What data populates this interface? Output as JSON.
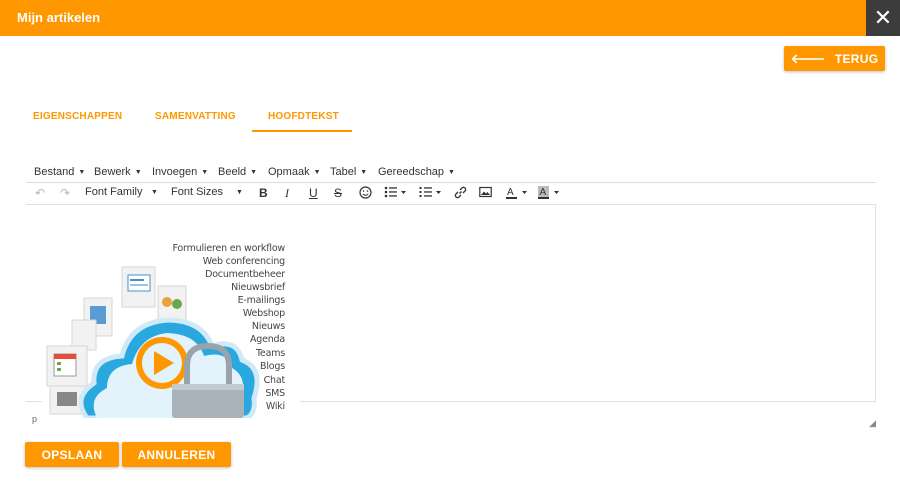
{
  "window": {
    "title": "Mijn artikelen",
    "close_symbol": "✕"
  },
  "back_button": {
    "arrow": "🡐",
    "label": "TERUG"
  },
  "tabs": [
    {
      "label": "EIGENSCHAPPEN"
    },
    {
      "label": "SAMENVATTING"
    },
    {
      "label": "HOOFDTEKST",
      "active": true
    }
  ],
  "editor": {
    "menus": [
      "Bestand",
      "Bewerk",
      "Invoegen",
      "Beeld",
      "Opmaak",
      "Tabel",
      "Gereedschap"
    ],
    "toolbar": {
      "font_family": "Font Family",
      "font_sizes": "Font Sizes",
      "bold": "B",
      "italic": "I",
      "underline": "U",
      "strike": "S"
    },
    "status_path": "p",
    "resize_symbol": "◢"
  },
  "illustration": {
    "labels": [
      "Formulieren en workflow",
      "Web conferencing",
      "Documentbeheer",
      "Nieuwsbrief",
      "E-mailings",
      "Webshop",
      "Nieuws",
      "Agenda",
      "Teams",
      "Blogs",
      "Chat",
      "SMS",
      "Wiki"
    ]
  },
  "footer": {
    "save_label": "OPSLAAN",
    "cancel_label": "ANNULEREN"
  },
  "colors": {
    "accent": "#ff9800",
    "close_bg": "#3c3c3c",
    "cloud": "#29a8e0",
    "play": "#ff9800"
  }
}
